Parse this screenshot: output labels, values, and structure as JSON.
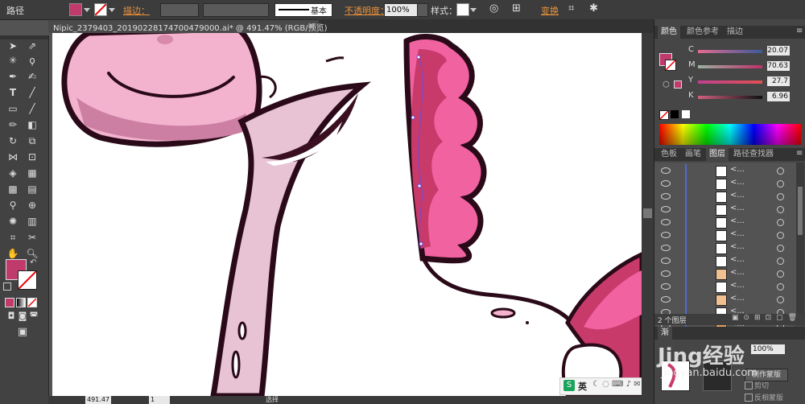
{
  "control_bar": {
    "object_type": "路径",
    "stroke_label": "描边：",
    "stroke_style": "基本",
    "opacity_label": "不透明度：",
    "opacity_value": "100%",
    "style_label": "样式：",
    "transform_label": "变换"
  },
  "document": {
    "tab_title": "Nipic_2379403_20190228174700479000.ai* @ 491.47% (RGB/预览)"
  },
  "colors": {
    "fill": "#c03a6c",
    "pink_light": "#f3b3ce",
    "pink_mid": "#f062a0",
    "pink_dark": "#c83a6a",
    "outline": "#2a0a18"
  },
  "color_panel": {
    "tabs": [
      "颜色",
      "颜色参考",
      "描边"
    ],
    "channels": [
      {
        "label": "C",
        "value": "20.07"
      },
      {
        "label": "M",
        "value": "70.63"
      },
      {
        "label": "Y",
        "value": "27.7"
      },
      {
        "label": "K",
        "value": "6.96"
      }
    ]
  },
  "layers_panel": {
    "tabs": [
      "色板",
      "画笔",
      "图层",
      "路径查找器"
    ],
    "row_name": "<...",
    "rows": 13,
    "footer_count": "2 个图层"
  },
  "transparency_panel": {
    "opacity_value": "100%",
    "make_mask": "制作蒙版",
    "clip": "剪切",
    "invert": "反相蒙版"
  },
  "status_bar": {
    "zoom": "491.47",
    "page": "1",
    "mode": "选择"
  },
  "ime": {
    "lang": "英"
  },
  "watermark": {
    "text": "Jing经验",
    "site": "jingyan.baidu.com"
  }
}
